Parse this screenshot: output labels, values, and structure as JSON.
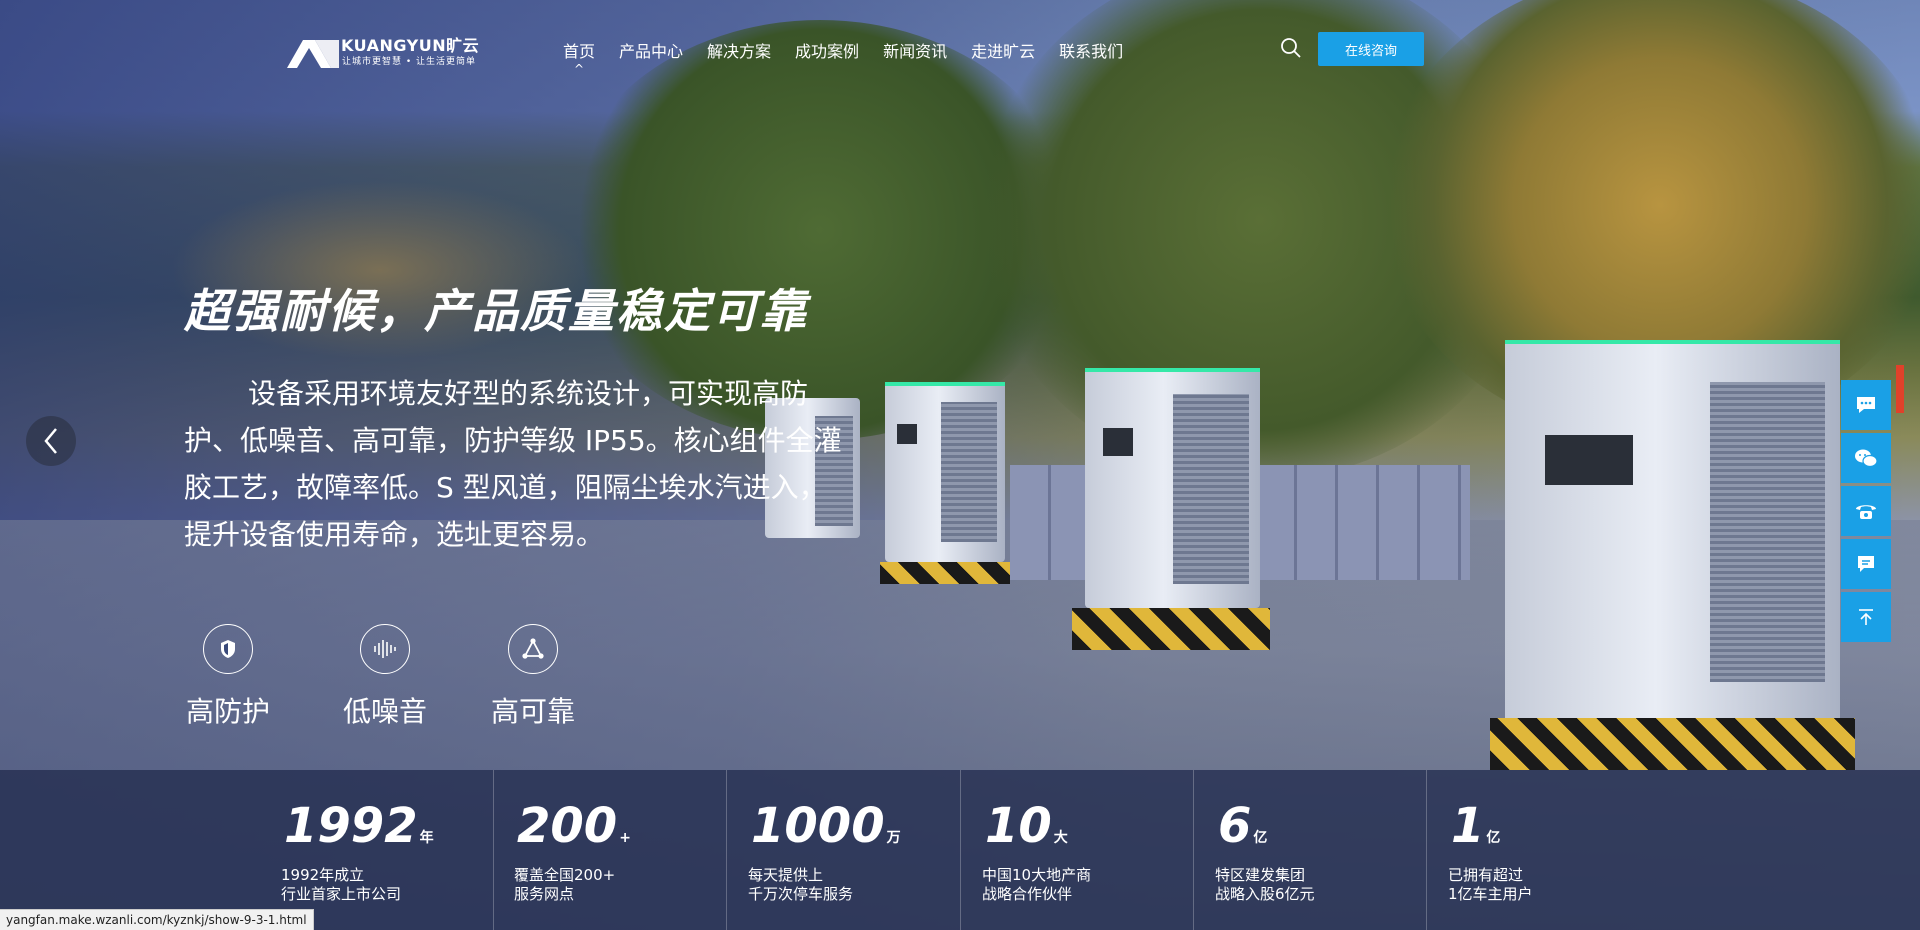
{
  "header": {
    "brand": "KUANGYUN旷云",
    "slogan": "让城市更智慧 • 让生活更简单",
    "nav": [
      "首页",
      "产品中心",
      "解决方案",
      "成功案例",
      "新闻资讯",
      "走进旷云",
      "联系我们"
    ],
    "active_nav": "首页",
    "consult_label": "在线咨询"
  },
  "hero": {
    "headline": "超强耐候，产品质量稳定可靠",
    "description": "设备采用环境友好型的系统设计，可实现高防护、低噪音、高可靠，防护等级 IP55。核心组件全灌胶工艺，故障率低。S 型风道，阻隔尘埃水汽进入，提升设备使用寿命，选址更容易。",
    "features": [
      {
        "icon": "shield-icon",
        "label": "高防护"
      },
      {
        "icon": "soundwave-icon",
        "label": "低噪音"
      },
      {
        "icon": "network-icon",
        "label": "高可靠"
      }
    ]
  },
  "stats": [
    {
      "value": "1992",
      "unit": "年",
      "line1": "1992年成立",
      "line2": "行业首家上市公司"
    },
    {
      "value": "200",
      "unit": "+",
      "line1": "覆盖全国200+",
      "line2": "服务网点"
    },
    {
      "value": "1000",
      "unit": "万",
      "line1": "每天提供上",
      "line2": "千万次停车服务"
    },
    {
      "value": "10",
      "unit": "大",
      "line1": "中国10大地产商",
      "line2": "战略合作伙伴"
    },
    {
      "value": "6",
      "unit": "亿",
      "line1": "特区建发集团",
      "line2": "战略入股6亿元"
    },
    {
      "value": "1",
      "unit": "亿",
      "line1": "已拥有超过",
      "line2": "1亿车主用户"
    }
  ],
  "side_toolbar": [
    "chat-icon",
    "wechat-icon",
    "phone-icon",
    "message-icon",
    "back-to-top-icon"
  ],
  "status_bar": {
    "url": "yangfan.make.wzanli.com/kyznkj/show-9-3-1.html"
  },
  "colors": {
    "accent": "#1aa0e6",
    "band": "#263052"
  }
}
